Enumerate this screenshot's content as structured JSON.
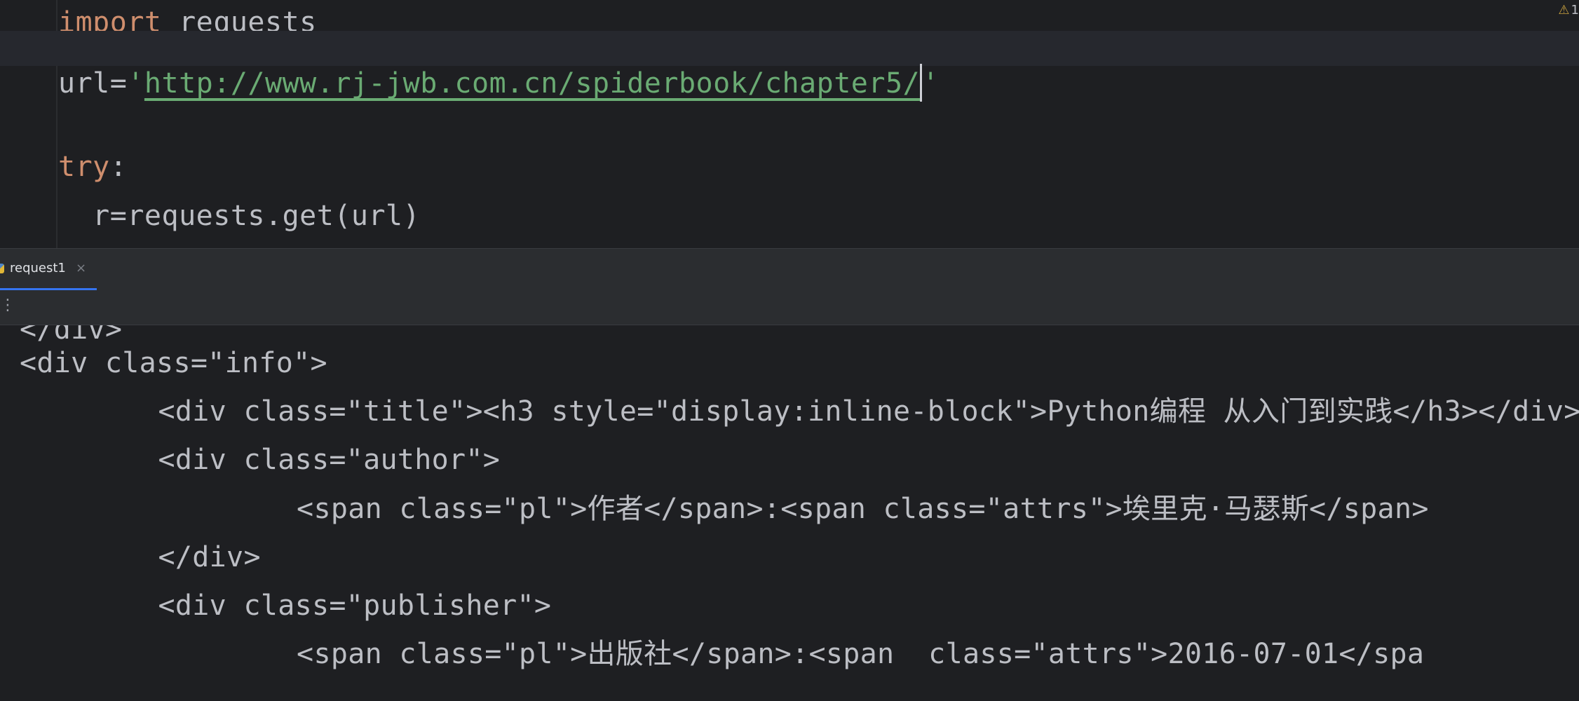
{
  "editor": {
    "lines": [
      {
        "keyword": "import",
        "rest": " requests"
      },
      {
        "prefix": "url=",
        "quote_open": "'",
        "url": "http://www.rj-jwb.com.cn/spiderbook/chapter5/",
        "quote_close": "'"
      },
      {
        "text": ""
      },
      {
        "keyword": "try",
        "rest": ":"
      },
      {
        "text": "  r=requests.get(url)"
      }
    ],
    "warning_count": "1"
  },
  "run_panel": {
    "tab_label": "request1",
    "close_glyph": "×",
    "more_glyph": "⋮",
    "output_lines": [
      "</div>",
      "<div class=\"info\">",
      "    <div class=\"title\"><h3 style=\"display:inline-block\">Python编程 从入门到实践</h3></div>",
      "    <div class=\"author\">",
      "        <span class=\"pl\">作者</span>:<span class=\"attrs\">埃里克·马瑟斯</span>",
      "    </div>",
      "    <div class=\"publisher\">",
      "        <span class=\"pl\">出版社</span>:<span  class=\"attrs\">2016-07-01</spa"
    ]
  },
  "colors": {
    "background": "#1e1f22",
    "keyword": "#cf8e6d",
    "string": "#6aab73",
    "text": "#bcbec4",
    "tab_underline": "#3574f0",
    "warning": "#c9a13e"
  },
  "icons": {
    "warning": "warning-triangle-icon",
    "tab": "python-file-icon",
    "close": "close-icon",
    "more": "more-vertical-icon"
  }
}
